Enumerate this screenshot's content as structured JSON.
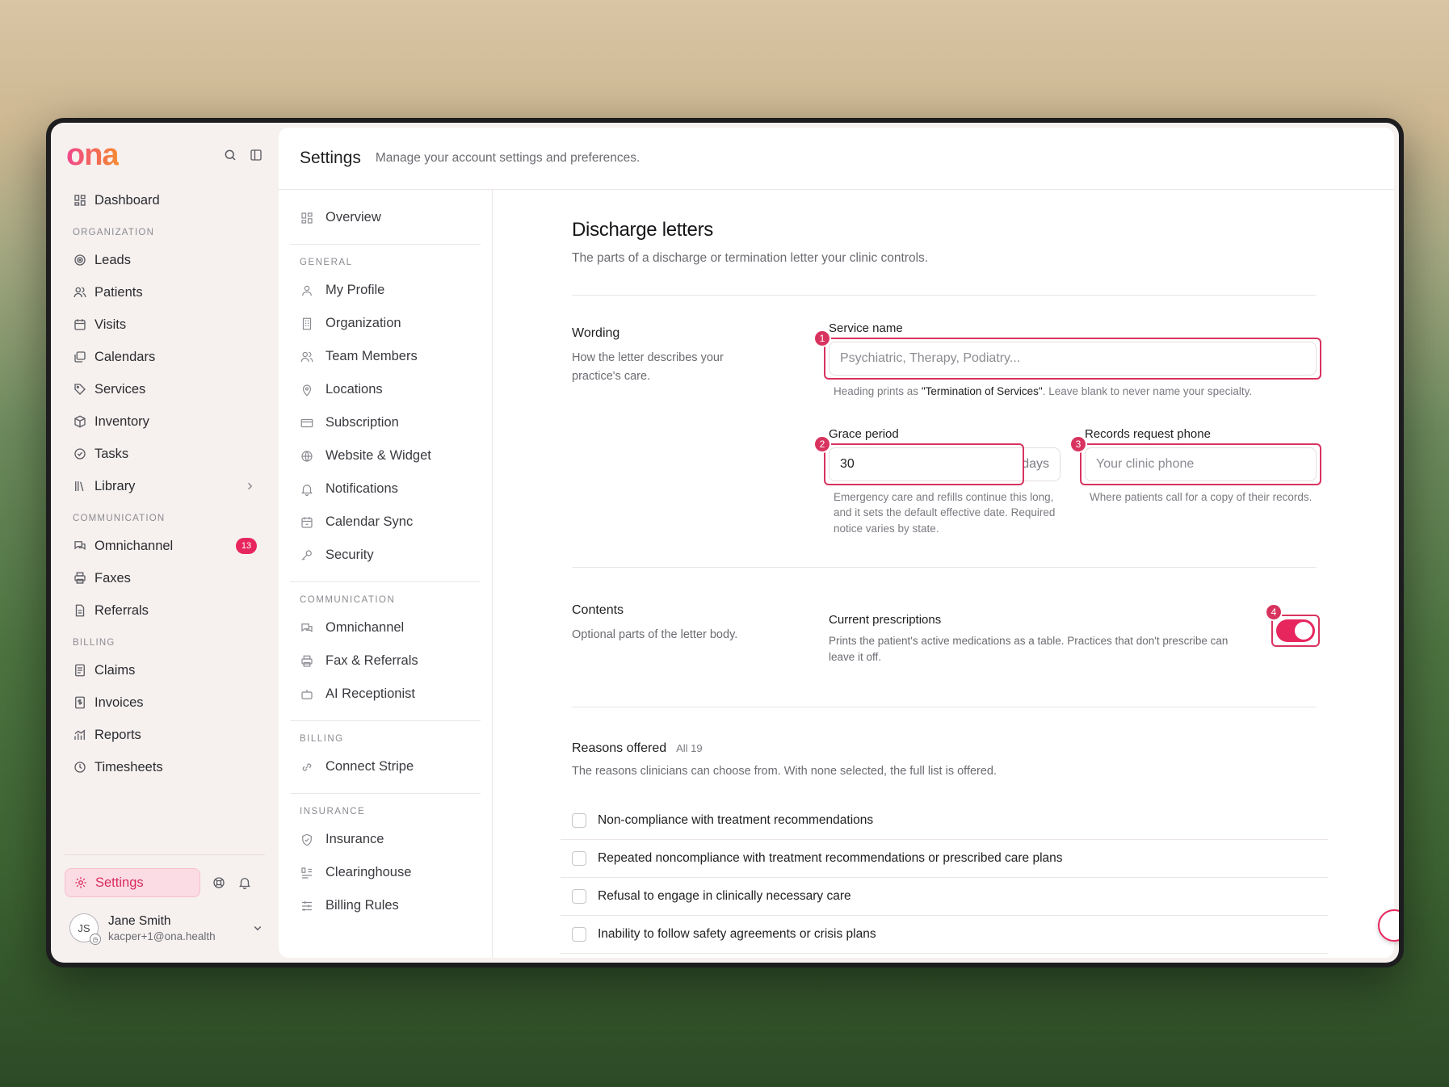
{
  "brand": {
    "logo": "ona"
  },
  "sidebar": {
    "dashboard": "Dashboard",
    "sections": [
      {
        "title": "ORGANIZATION",
        "items": [
          {
            "label": "Leads",
            "icon": "target-icon"
          },
          {
            "label": "Patients",
            "icon": "users-icon"
          },
          {
            "label": "Visits",
            "icon": "calendar-icon"
          },
          {
            "label": "Calendars",
            "icon": "calendars-icon"
          },
          {
            "label": "Services",
            "icon": "tag-icon"
          },
          {
            "label": "Inventory",
            "icon": "box-icon"
          },
          {
            "label": "Tasks",
            "icon": "check-circle-icon"
          },
          {
            "label": "Library",
            "icon": "library-icon"
          }
        ]
      },
      {
        "title": "COMMUNICATION",
        "items": [
          {
            "label": "Omnichannel",
            "icon": "chat-icon",
            "badge": "13"
          },
          {
            "label": "Faxes",
            "icon": "printer-icon"
          },
          {
            "label": "Referrals",
            "icon": "document-icon"
          }
        ]
      },
      {
        "title": "BILLING",
        "items": [
          {
            "label": "Claims",
            "icon": "claims-icon"
          },
          {
            "label": "Invoices",
            "icon": "invoice-icon"
          },
          {
            "label": "Reports",
            "icon": "chart-icon"
          },
          {
            "label": "Timesheets",
            "icon": "clock-icon"
          }
        ]
      }
    ],
    "settings_label": "Settings",
    "user": {
      "initials": "JS",
      "name": "Jane Smith",
      "email": "kacper+1@ona.health"
    }
  },
  "header": {
    "title": "Settings",
    "subtitle": "Manage your account settings and preferences."
  },
  "subnav": {
    "overview": "Overview",
    "general_title": "GENERAL",
    "general": [
      "My Profile",
      "Organization",
      "Team Members",
      "Locations",
      "Subscription",
      "Website & Widget",
      "Notifications",
      "Calendar Sync",
      "Security"
    ],
    "communication_title": "COMMUNICATION",
    "communication": [
      "Omnichannel",
      "Fax & Referrals",
      "AI Receptionist"
    ],
    "billing_title": "BILLING",
    "billing": [
      "Connect Stripe"
    ],
    "insurance_title": "INSURANCE",
    "insurance": [
      "Insurance",
      "Clearinghouse",
      "Billing Rules"
    ]
  },
  "page": {
    "title": "Discharge letters",
    "description": "The parts of a discharge or termination letter your clinic controls.",
    "wording": {
      "title": "Wording",
      "description": "How the letter describes your practice's care.",
      "service_name_label": "Service name",
      "service_name_placeholder": "Psychiatric, Therapy, Podiatry...",
      "service_help_pre": "Heading prints as ",
      "service_help_bold": "\"Termination of Services\"",
      "service_help_post": ". Leave blank to never name your specialty.",
      "grace_label": "Grace period",
      "grace_value": "30",
      "grace_suffix": "days",
      "grace_help": "Emergency care and refills continue this long, and it sets the default effective date. Required notice varies by state.",
      "phone_label": "Records request phone",
      "phone_placeholder": "Your clinic phone",
      "phone_help": "Where patients call for a copy of their records."
    },
    "contents": {
      "title": "Contents",
      "description": "Optional parts of the letter body.",
      "rx_title": "Current prescriptions",
      "rx_desc": "Prints the patient's active medications as a table. Practices that don't prescribe can leave it off.",
      "rx_enabled": true
    },
    "reasons": {
      "title": "Reasons offered",
      "count": "All 19",
      "description": "The reasons clinicians can choose from. With none selected, the full list is offered.",
      "items": [
        "Non-compliance with treatment recommendations",
        "Repeated noncompliance with treatment recommendations or prescribed care plans",
        "Refusal to engage in clinically necessary care",
        "Inability to follow safety agreements or crisis plans"
      ]
    }
  },
  "annotations": [
    "1",
    "2",
    "3",
    "4"
  ],
  "colors": {
    "accent": "#e8265e",
    "highlight": "#d8335f"
  }
}
